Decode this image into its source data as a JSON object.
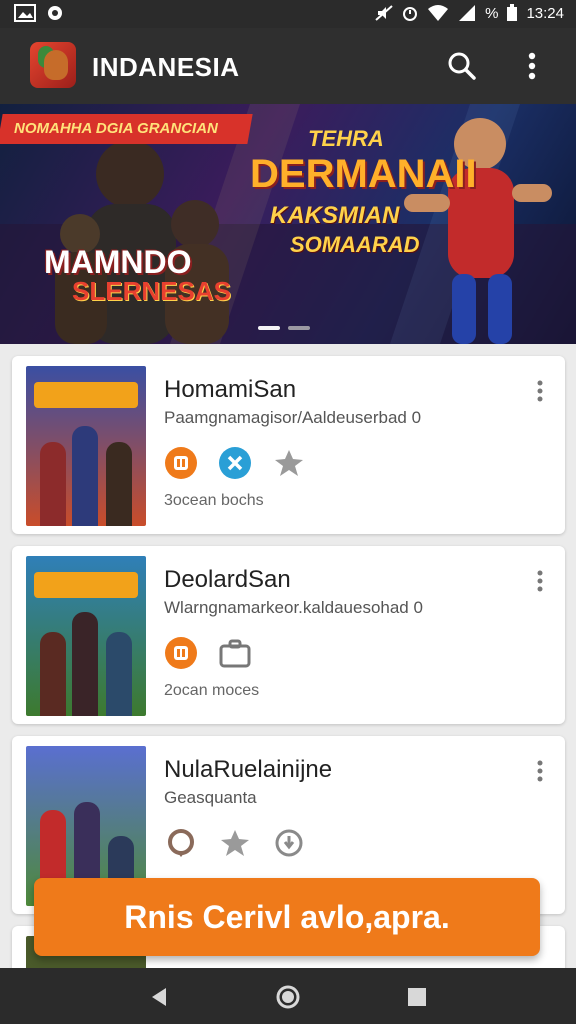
{
  "status": {
    "percent": "%",
    "time": "13:24"
  },
  "appbar": {
    "title": "INDANESIA",
    "search_icon": "search-icon",
    "more_icon": "more-vert-icon"
  },
  "banner": {
    "ribbon": "NOMAHHA DGIA GRANCIAN",
    "left_title": "MAMNDO",
    "left_subtitle": "SLERNESAS",
    "right_line1": "TEHRA",
    "right_line2": "DERMANAII",
    "right_line3": "KAKSMIAN",
    "right_line4": "SOMAARAD"
  },
  "cards": [
    {
      "title": "HomamiSan",
      "subtitle": "Paamgnamagisor/Aaldeuserbad 0",
      "meta": "3ocean bochs",
      "icons": [
        "tv-icon",
        "close-circle-icon",
        "star-icon"
      ]
    },
    {
      "title": "DeolardSan",
      "subtitle": "Wlarngnamarkeor.kaldauesohad 0",
      "meta": "2ocan moces",
      "icons": [
        "tv-icon",
        "briefcase-icon"
      ]
    },
    {
      "title": "NulaRuelainijne",
      "subtitle": "Geasquanta",
      "meta": "",
      "icons": [
        "chat-icon",
        "star-icon",
        "download-icon"
      ]
    }
  ],
  "cta": {
    "label": "Rnis Cerivl avlo,apra."
  },
  "colors": {
    "accent": "#ef7a1a",
    "bar": "#2f2f2f",
    "teal": "#2a9fd6"
  }
}
